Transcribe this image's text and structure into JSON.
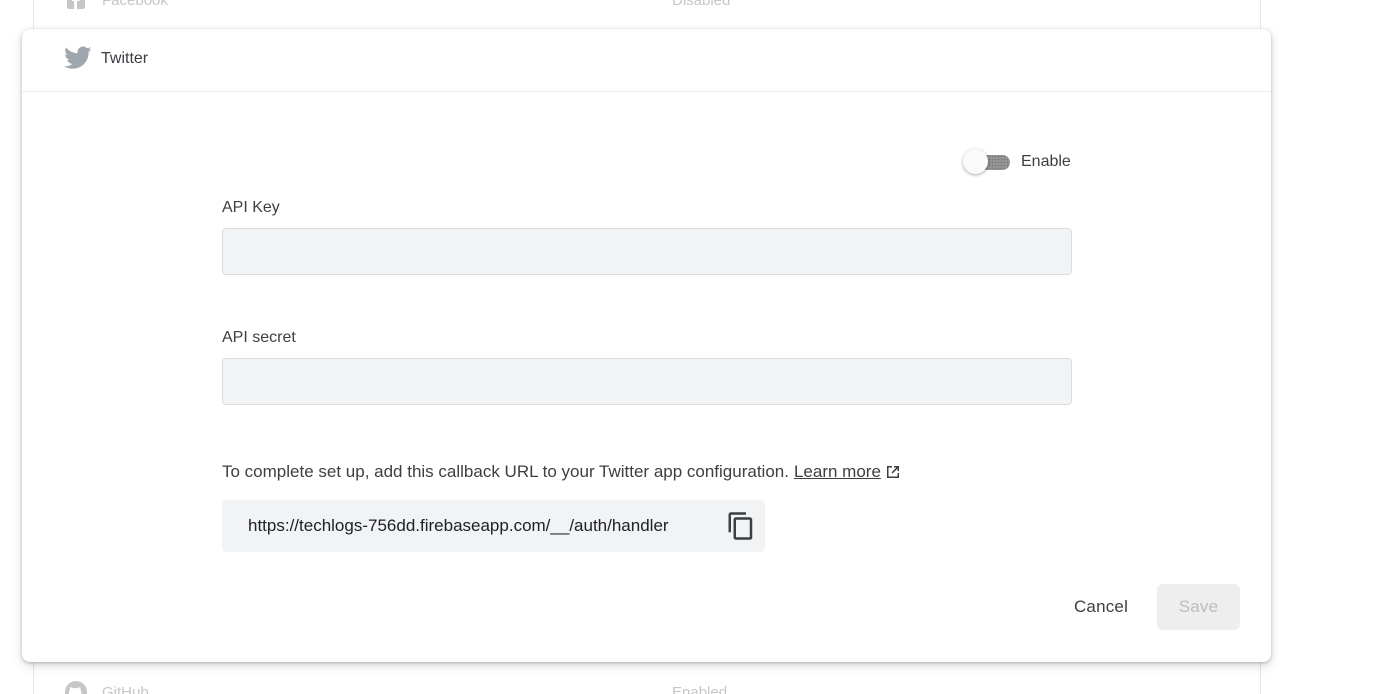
{
  "background_list": {
    "top_row": {
      "name": "Facebook",
      "status": "Disabled",
      "icon": "facebook-icon"
    },
    "bottom_row": {
      "name": "GitHub",
      "status": "Enabled",
      "icon": "github-icon"
    }
  },
  "panel": {
    "provider_name": "Twitter",
    "provider_icon": "twitter-icon",
    "enable_label": "Enable",
    "enable_on": false,
    "api_key": {
      "label": "API Key",
      "value": "",
      "placeholder": ""
    },
    "api_secret": {
      "label": "API secret",
      "value": "",
      "placeholder": ""
    },
    "callback_note": "To complete set up, add this callback URL to your Twitter app configuration.",
    "learn_more_label": "Learn more",
    "callback_url": "https://techlogs-756dd.firebaseapp.com/__/auth/handler",
    "cancel_label": "Cancel",
    "save_label": "Save"
  },
  "colors": {
    "icon_gray": "#a0a6ad",
    "input_bg": "#f1f3f4",
    "text": "#3c4043",
    "save_disabled_bg": "#eeeeee",
    "save_disabled_text": "#bdbdbd"
  }
}
